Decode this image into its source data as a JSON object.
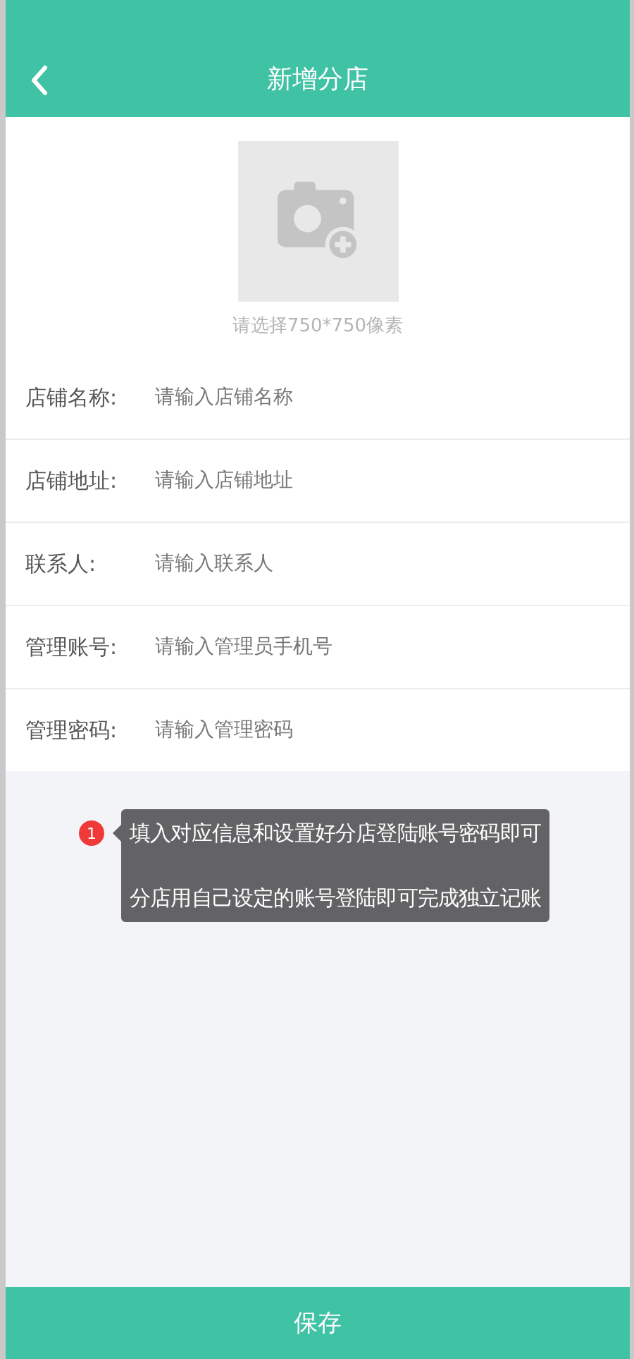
{
  "header": {
    "title": "新增分店"
  },
  "photo": {
    "hint": "请选择750*750像素"
  },
  "fields": [
    {
      "label": "店铺名称:",
      "placeholder": "请输入店铺名称"
    },
    {
      "label": "店铺地址:",
      "placeholder": "请输入店铺地址"
    },
    {
      "label": "联系人:",
      "placeholder": "请输入联系人"
    },
    {
      "label": "管理账号:",
      "placeholder": "请输入管理员手机号"
    },
    {
      "label": "管理密码:",
      "placeholder": "请输入管理密码"
    }
  ],
  "tip": {
    "badge": "1",
    "lines": [
      "填入对应信息和设置好分店登陆账号密码即可",
      "分店用自己设定的账号登陆即可完成独立记账"
    ]
  },
  "save_button": "保存"
}
